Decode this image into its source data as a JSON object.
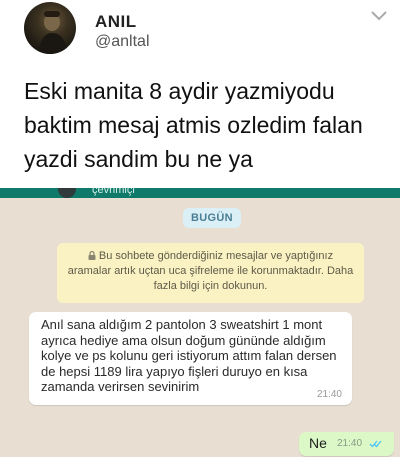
{
  "tweet": {
    "display_name": "ANIL",
    "handle": "@anltal",
    "text_lines": [
      "Eski manita 8 aydir yazmiyodu",
      "baktim mesaj atmis ozledim falan",
      "yazdi sandim bu ne ya"
    ],
    "menu_icon": "chevron-down-icon",
    "avatar_icon": "avatar"
  },
  "chat": {
    "topbar_text": "çevrimiçi",
    "date_label": "BUGÜN",
    "notice_text": "Bu sohbete gönderdiğiniz mesajlar ve yaptığınız aramalar artık uçtan uca şifreleme ile korunmaktadır. Daha fazla bilgi için dokunun.",
    "incoming": {
      "text": "Anıl sana aldığım 2 pantolon 3 sweatshirt 1 mont ayrıca hediye ama olsun doğum gününde aldığım kolye ve ps kolunu geri istiyorum attım falan dersen de hepsi 1189 lira yapıyo fişleri duruyo en kısa zamanda verirsen sevinirim",
      "time": "21:40"
    },
    "outgoing": {
      "text": "Ne",
      "time": "21:40",
      "status_icon": "double-check-icon"
    },
    "colors": {
      "background": "#e8dfd2",
      "header": "#0f7a6a",
      "outgoing_bubble": "#dcf8c6",
      "notice_bg": "#fbf2c4",
      "read_ticks": "#4fc3f7"
    }
  }
}
